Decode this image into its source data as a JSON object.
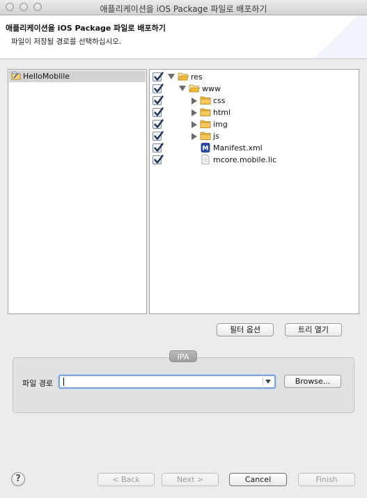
{
  "window": {
    "title": "애플리케이션을 iOS Package 파일로 배포하기"
  },
  "header": {
    "title": "애플리케이션을 iOS Package 파일로 배포하기",
    "description": "파일이 저장될 경로를 선택하십시오."
  },
  "projects": [
    {
      "label": "HelloMoblile",
      "icon": "project-icon",
      "selected": true
    }
  ],
  "tree": [
    {
      "label": "res",
      "type": "folder",
      "checked": true,
      "expanded": true,
      "depth": 0
    },
    {
      "label": "www",
      "type": "folder",
      "checked": true,
      "expanded": true,
      "depth": 1
    },
    {
      "label": "css",
      "type": "folder",
      "checked": true,
      "expanded": false,
      "depth": 2
    },
    {
      "label": "html",
      "type": "folder",
      "checked": true,
      "expanded": false,
      "depth": 2
    },
    {
      "label": "img",
      "type": "folder",
      "checked": true,
      "expanded": false,
      "depth": 2
    },
    {
      "label": "js",
      "type": "folder",
      "checked": true,
      "expanded": false,
      "depth": 2
    },
    {
      "label": "Manifest.xml",
      "type": "manifest",
      "checked": true,
      "depth": 2
    },
    {
      "label": "mcore.mobile.lic",
      "type": "file",
      "checked": true,
      "depth": 2
    }
  ],
  "buttons": {
    "filter_options": "필터 옵션",
    "open_tree": "트리 열기",
    "browse": "Browse...",
    "back": "< Back",
    "next": "Next >",
    "cancel": "Cancel",
    "finish": "Finish"
  },
  "ipa": {
    "group_label": "IPA",
    "path_label": "파일 경로",
    "path_value": ""
  },
  "help": {
    "label": "?"
  },
  "colors": {
    "folder": "#f5b73b",
    "checkbox_tick": "#1b2f57",
    "focus_ring": "#7aa6e0"
  }
}
